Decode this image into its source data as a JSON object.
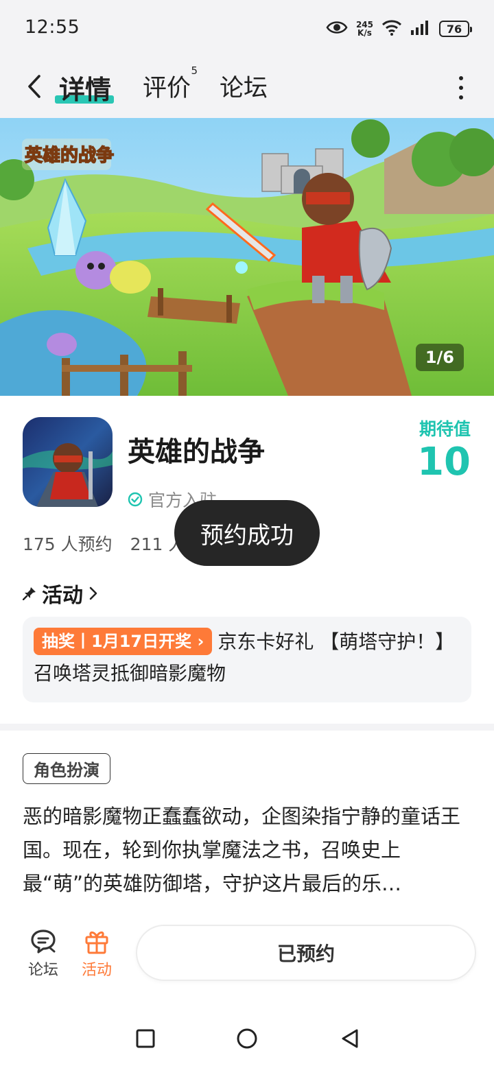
{
  "status_bar": {
    "time": "12:55",
    "net_speed_value": "245",
    "net_speed_unit": "K/s",
    "battery": "76",
    "icons": [
      "eye-icon",
      "wifi-icon",
      "signal-icon",
      "battery-icon"
    ]
  },
  "header": {
    "tabs": [
      {
        "label": "详情",
        "active": true
      },
      {
        "label": "评价",
        "badge": "5"
      },
      {
        "label": "论坛"
      }
    ]
  },
  "banner": {
    "counter": "1/6",
    "logo_text": "英雄的战争"
  },
  "game": {
    "title": "英雄的战争",
    "official_label": "官方入驻",
    "expect_label": "期待值",
    "expect_value": "10",
    "stats": {
      "reservations": "175 人预约",
      "followers": "211 人"
    }
  },
  "toast": {
    "message": "预约成功"
  },
  "activity": {
    "header_label": "活动",
    "tag": "抽奖丨1月17日开奖",
    "text": "京东卡好礼 【萌塔守护！】召唤塔灵抵御暗影魔物"
  },
  "detail": {
    "genre_tag": "角色扮演",
    "description": "恶的暗影魔物正蠢蠢欲动，企图染指宁静的童话王国。现在，轮到你执掌魔法之书，召唤史上最“萌”的英雄防御塔，守护这片最后的乐…"
  },
  "bottom_bar": {
    "forum_label": "论坛",
    "activity_label": "活动",
    "reserved_label": "已预约"
  },
  "colors": {
    "accent_teal": "#1fc4b0",
    "accent_orange": "#fe7a38",
    "toast_bg": "#262626"
  }
}
